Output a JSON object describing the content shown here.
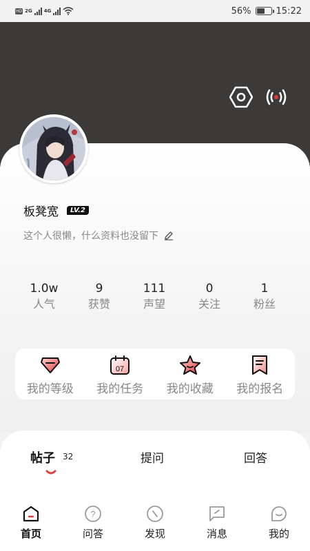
{
  "status_bar": {
    "hd": "HD",
    "net1": "2G",
    "net2": "4G",
    "battery_text": "56%",
    "battery_level": 0.56,
    "time": "15:22"
  },
  "header": {
    "settings_icon": "hexagon-settings-icon",
    "live_icon": "broadcast-icon",
    "accent": "#e23b3b"
  },
  "profile": {
    "username": "板凳宽",
    "level": "LV.2",
    "bio": "这个人很懒，什么资料也没留下",
    "stats": [
      {
        "value": "1.0w",
        "label": "人气"
      },
      {
        "value": "9",
        "label": "获赞"
      },
      {
        "value": "111",
        "label": "声望"
      },
      {
        "value": "0",
        "label": "关注"
      },
      {
        "value": "1",
        "label": "粉丝"
      }
    ]
  },
  "quick_actions": [
    {
      "label": "我的等级",
      "icon": "diamond-icon"
    },
    {
      "label": "我的任务",
      "icon": "calendar-icon",
      "icon_text": "07"
    },
    {
      "label": "我的收藏",
      "icon": "star-icon"
    },
    {
      "label": "我的报名",
      "icon": "bookmark-icon"
    }
  ],
  "content_tabs": {
    "items": [
      {
        "label": "帖子",
        "count": "32"
      },
      {
        "label": "提问"
      },
      {
        "label": "回答"
      }
    ],
    "active": 0
  },
  "bottom_nav": {
    "items": [
      {
        "label": "首页",
        "icon": "home-icon"
      },
      {
        "label": "问答",
        "icon": "question-icon"
      },
      {
        "label": "发现",
        "icon": "compass-icon"
      },
      {
        "label": "消息",
        "icon": "message-icon"
      },
      {
        "label": "我的",
        "icon": "profile-icon"
      }
    ],
    "active": 0
  }
}
